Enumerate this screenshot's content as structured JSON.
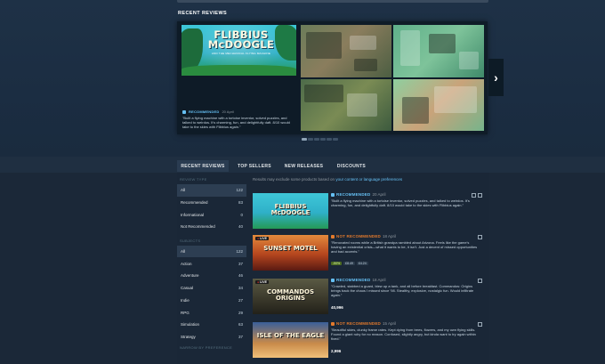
{
  "section": {
    "title": "RECENT REVIEWS"
  },
  "featured": {
    "cover_title": "FLIBBIUS McDOOGLE",
    "cover_subtitle": "AND THE MECHANICAL FLYING MACHINE",
    "status": "RECOMMENDED",
    "date": "20 April",
    "text": "\"Built a flying machine with a tortoise inventor, solved puzzles, and talked to weirdos. It's charming, fun, and delightfully daft. 8/10 would take to the skies with Flibbius again.\""
  },
  "carousel": {
    "next_icon": "chevron-right",
    "dots": 6,
    "active_dot": 0
  },
  "tabs": [
    {
      "label": "RECENT REVIEWS",
      "active": true
    },
    {
      "label": "TOP SELLERS",
      "active": false
    },
    {
      "label": "NEW RELEASES",
      "active": false
    },
    {
      "label": "DISCOUNTS",
      "active": false
    }
  ],
  "filters": {
    "review_type_heading": "REVIEW TYPE",
    "review_types": [
      {
        "label": "All",
        "count": "122"
      },
      {
        "label": "Recommended",
        "count": "83"
      },
      {
        "label": "Informational",
        "count": "0"
      },
      {
        "label": "Not Recommended",
        "count": "40"
      }
    ],
    "subjects_heading": "SUBJECTS",
    "subjects": [
      {
        "label": "All",
        "count": "122"
      },
      {
        "label": "Action",
        "count": "37"
      },
      {
        "label": "Adventure",
        "count": "46"
      },
      {
        "label": "Casual",
        "count": "34"
      },
      {
        "label": "Indie",
        "count": "27"
      },
      {
        "label": "RPG",
        "count": "29"
      },
      {
        "label": "Simulation",
        "count": "63"
      },
      {
        "label": "Strategy",
        "count": "37"
      }
    ],
    "more_heading": "NARROW BY PREFERENCE"
  },
  "results_note": {
    "text": "Results may exclude some products based on ",
    "link": "your content or language preferences"
  },
  "reviews": [
    {
      "status": "RECOMMENDED",
      "kind": "rec",
      "date": "20 April",
      "live": false,
      "text": "\"Built a flying machine with a tortoise inventor, solved puzzles, and talked to weirdos. It's charming, fun, and delightfully daft. 8/10 would take to the skies with Flibbius again.\"",
      "footer": "",
      "art_title": "FLIBBIUS McDOOGLE"
    },
    {
      "status": "NOT RECOMMENDED",
      "kind": "notrec",
      "date": "18 April",
      "live": true,
      "text": "\"Renovated rooms while a British grandpa rambled about Arizona. Feels like the game's having an existential crisis—what it wants to be, it isn't. Just a decent of missed opportunities and bad accents.\"",
      "footer": "",
      "art_title": "SUNSET MOTEL",
      "tags": [
        "-50%",
        "£8.49",
        "£4.24"
      ]
    },
    {
      "status": "RECOMMENDED",
      "kind": "rec",
      "date": "18 April",
      "live": true,
      "text": "\"Crawled, stabbed a guard, blew up a tank, and all before breakfast. Commandos: Origins brings back the chaos I missed since '98. Stealthy, explosive, nostalgic fun. Would infiltrate again.\"",
      "footer": "40,996",
      "art_title": "COMMANDOS ORIGINS"
    },
    {
      "status": "NOT RECOMMENDED",
      "kind": "notrec",
      "date": "15 April",
      "live": false,
      "text": "\"Beautiful skies, clunky frame rates. Kept dying from trees, flowers, and my own flying skills. Found a giant ruby for no reason. Confused, slightly angry, but kinda want to try again within fixed.\"",
      "footer": "2,996",
      "art_title": "ISLE OF THE EAGLE"
    }
  ],
  "colors": {
    "accent": "#66c0f4",
    "negative": "#e37a2c",
    "bg": "#1b2838"
  }
}
